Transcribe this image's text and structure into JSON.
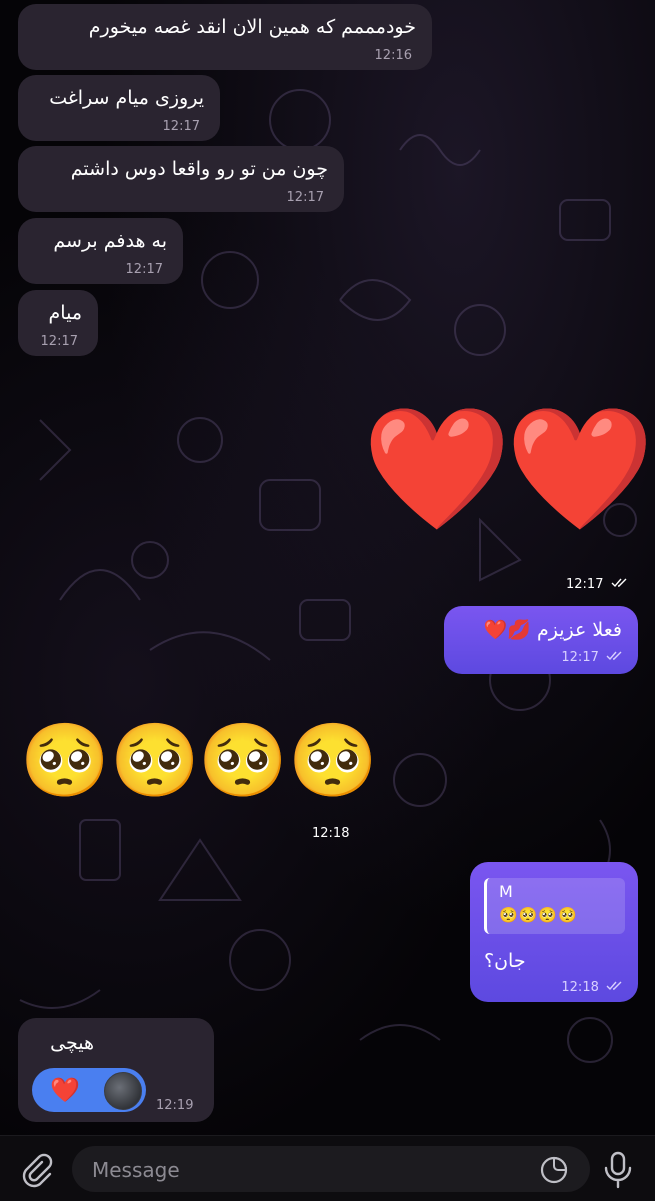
{
  "messages": {
    "m1": {
      "text": "خودمممم  که همین الان انقد غصه میخورم",
      "time": "12:16"
    },
    "m2": {
      "text": "یروزی میام سراغت",
      "time": "12:17"
    },
    "m3": {
      "text": "چون من تو رو واقعا دوس داشتم",
      "time": "12:17"
    },
    "m4": {
      "text": "به هدفم برسم",
      "time": "12:17"
    },
    "m5": {
      "text": "میام",
      "time": "12:17"
    },
    "hearts": {
      "emoji": "❤️",
      "time": "12:17"
    },
    "out1": {
      "text": "فعلا عزیزم 💋❤️",
      "time": "12:17"
    },
    "pleading": {
      "emoji": "🥺",
      "time": "12:18"
    },
    "out2": {
      "reply_name": "M",
      "reply_preview": "🥺🥺🥺🥺",
      "text": "جان؟",
      "time": "12:18"
    },
    "m6": {
      "text": "هیچی",
      "reaction": "❤️",
      "time": "12:19"
    }
  },
  "composer": {
    "placeholder": "Message"
  },
  "icons": {
    "attach": "paperclip-icon",
    "sticker": "sticker-icon",
    "mic": "microphone-icon",
    "read": "double-check-icon"
  },
  "colors": {
    "incoming": "#2a2430",
    "outgoing": "#6c4de6",
    "reaction_pill": "#4a7ff0"
  }
}
